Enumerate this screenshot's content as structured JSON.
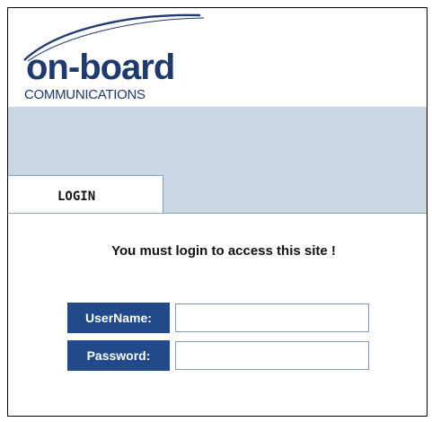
{
  "brand": {
    "logo_word": "on-board",
    "logo_sub": "COMMUNICATIONS",
    "logo_color": "#1f3a6e"
  },
  "tabs": {
    "login_label": "LOGIN"
  },
  "login_form": {
    "message": "You must login to access this site !",
    "username_label": "UserName:",
    "username_value": "",
    "password_label": "Password:",
    "password_value": ""
  },
  "colors": {
    "banner": "#cbd6e3",
    "label_bg": "#224a8a"
  }
}
